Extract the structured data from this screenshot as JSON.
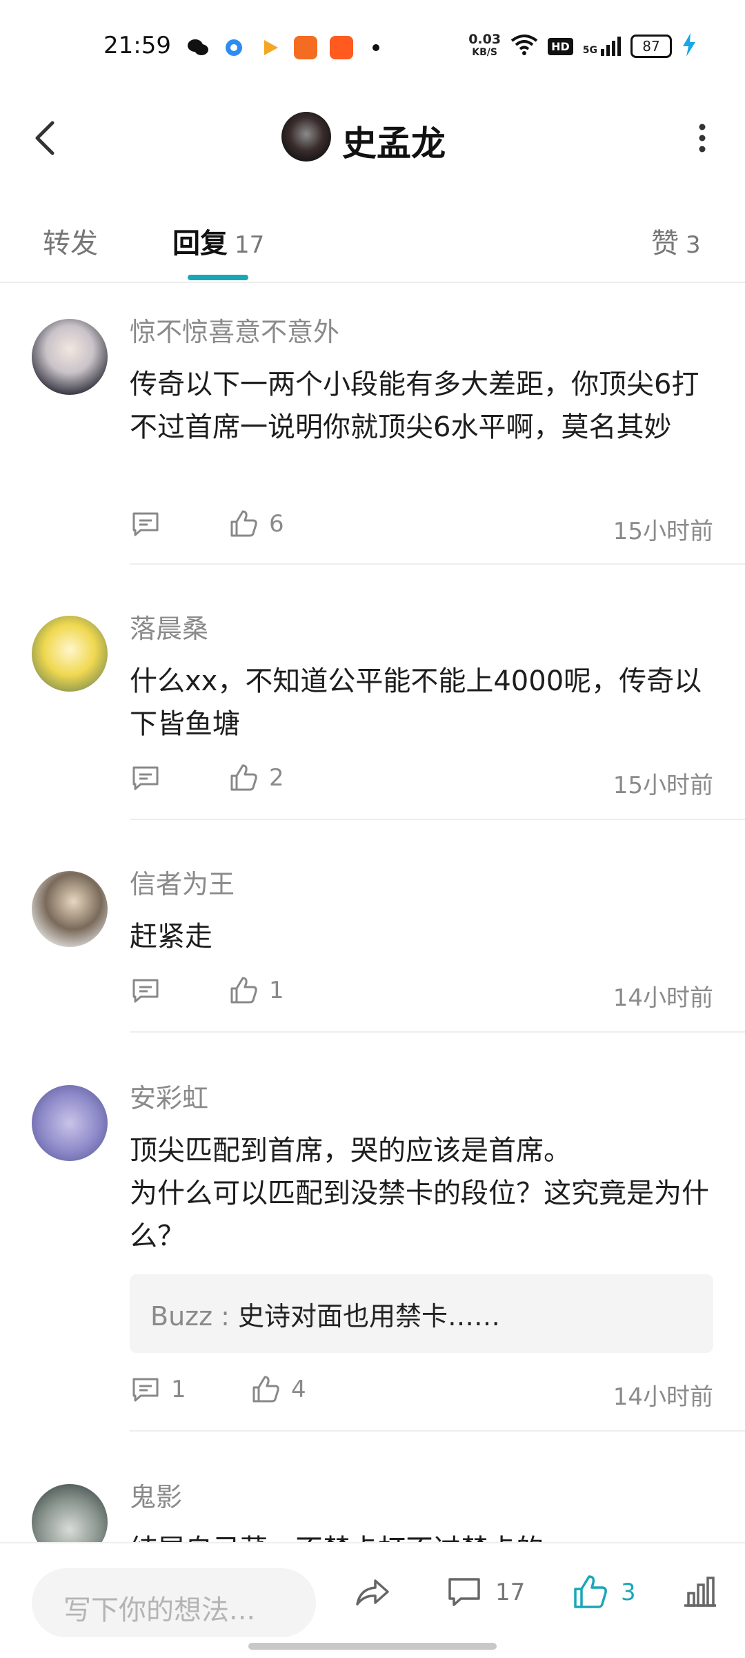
{
  "status_bar": {
    "time": "21:59",
    "net_speed_value": "0.03",
    "net_speed_unit": "KB/S",
    "battery": "87",
    "signal": "5G",
    "hd": "HD"
  },
  "header": {
    "title": "史孟龙"
  },
  "tabs": [
    {
      "label": "转发",
      "count": ""
    },
    {
      "label": "回复",
      "count": "17"
    },
    {
      "label": "赞",
      "count": "3"
    }
  ],
  "comments": [
    {
      "name": "惊不惊喜意不意外",
      "text": "传奇以下一两个小段能有多大差距，你顶尖6打不过首席一说明你就顶尖6水平啊，莫名其妙",
      "reply_count": "",
      "likes": "6",
      "time": "15小时前"
    },
    {
      "name": "落晨桑",
      "text": "什么xx，不知道公平能不能上4000呢，传奇以下皆鱼塘",
      "reply_count": "",
      "likes": "2",
      "time": "15小时前"
    },
    {
      "name": "信者为王",
      "text": "赶紧走",
      "reply_count": "",
      "likes": "1",
      "time": "14小时前"
    },
    {
      "name": "安彩虹",
      "text": "顶尖匹配到首席，哭的应该是首席。\n为什么可以匹配到没禁卡的段位？这究竟是为什么？",
      "reply": {
        "name": "Buzz",
        "text": "史诗对面也用禁卡……"
      },
      "reply_count": "1",
      "likes": "4",
      "time": "14小时前"
    },
    {
      "name": "鬼影",
      "text": "纯属自己菜，不禁卡打不过禁卡的"
    }
  ],
  "bottom_bar": {
    "input_placeholder": "写下你的想法...",
    "comments_count": "17",
    "likes_count": "3"
  },
  "colors": {
    "accent": "#19a7b8"
  }
}
